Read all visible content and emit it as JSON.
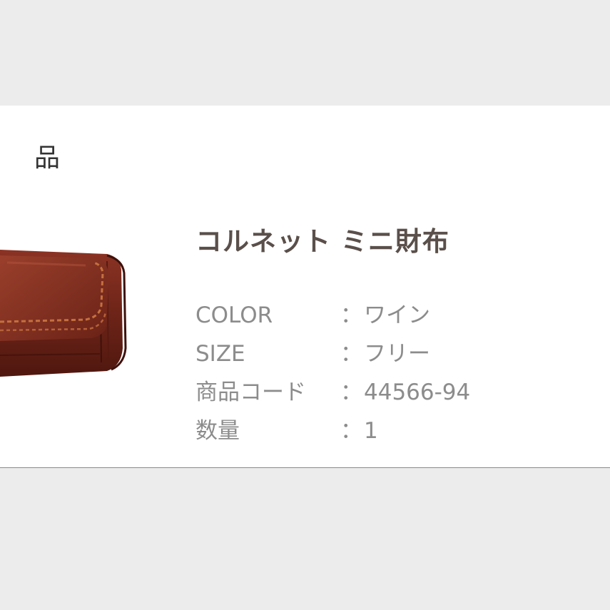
{
  "section": {
    "heading": "品"
  },
  "product": {
    "title": "コルネット ミニ財布",
    "image_alt": "wine leather mini wallet",
    "details": [
      {
        "label": "COLOR",
        "separator": "：",
        "value": "ワイン"
      },
      {
        "label": "SIZE",
        "separator": "：",
        "value": "フリー"
      },
      {
        "label": "商品コード",
        "separator": "：",
        "value": "44566-94"
      },
      {
        "label": "数量",
        "separator": "：",
        "value": "1"
      }
    ]
  },
  "colors": {
    "background": "#ececec",
    "card": "#ffffff",
    "title": "#5a4f4a",
    "detail_text": "#8c8c8c",
    "leather": "#7a2a1f"
  }
}
